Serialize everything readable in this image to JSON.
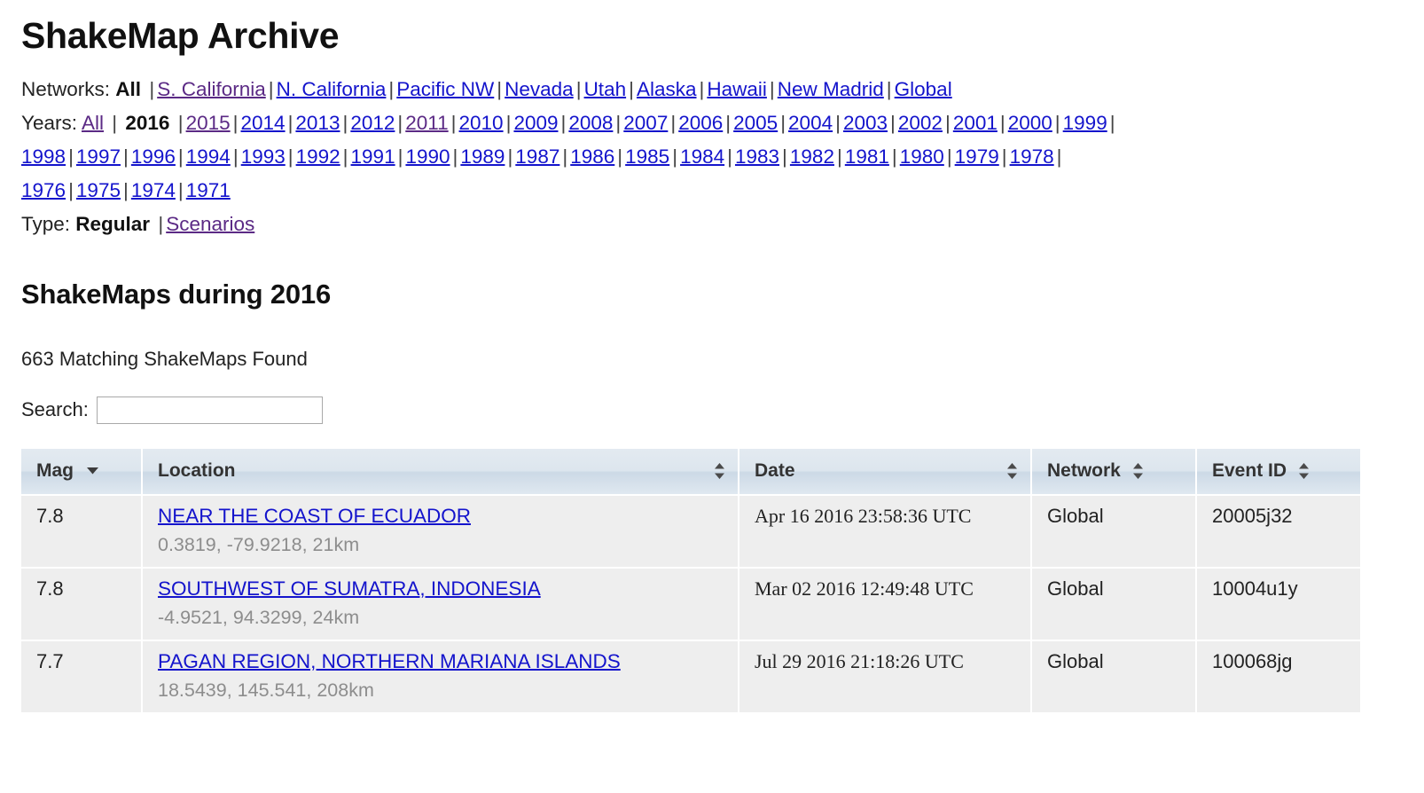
{
  "page": {
    "title": "ShakeMap Archive",
    "section_title": "ShakeMaps during 2016",
    "results_summary": "663 Matching ShakeMaps Found"
  },
  "filters": {
    "networks": {
      "label": "Networks:",
      "current": "All",
      "items": [
        {
          "label": "S. California",
          "visited": true
        },
        {
          "label": "N. California",
          "visited": false
        },
        {
          "label": "Pacific NW",
          "visited": false
        },
        {
          "label": "Nevada",
          "visited": false
        },
        {
          "label": "Utah",
          "visited": false
        },
        {
          "label": "Alaska",
          "visited": false
        },
        {
          "label": "Hawaii",
          "visited": false
        },
        {
          "label": "New Madrid",
          "visited": false
        },
        {
          "label": "Global",
          "visited": false
        }
      ]
    },
    "years": {
      "label": "Years:",
      "current": "2016",
      "all_label": "All",
      "all_visited": true,
      "items": [
        {
          "label": "2015",
          "visited": true
        },
        {
          "label": "2014",
          "visited": false
        },
        {
          "label": "2013",
          "visited": false
        },
        {
          "label": "2012",
          "visited": false
        },
        {
          "label": "2011",
          "visited": true
        },
        {
          "label": "2010",
          "visited": false
        },
        {
          "label": "2009",
          "visited": false
        },
        {
          "label": "2008",
          "visited": false
        },
        {
          "label": "2007",
          "visited": false
        },
        {
          "label": "2006",
          "visited": false
        },
        {
          "label": "2005",
          "visited": false
        },
        {
          "label": "2004",
          "visited": false
        },
        {
          "label": "2003",
          "visited": false
        },
        {
          "label": "2002",
          "visited": false
        },
        {
          "label": "2001",
          "visited": false
        },
        {
          "label": "2000",
          "visited": false
        },
        {
          "label": "1999",
          "visited": false
        },
        {
          "label": "1998",
          "visited": false
        },
        {
          "label": "1997",
          "visited": false
        },
        {
          "label": "1996",
          "visited": false
        },
        {
          "label": "1994",
          "visited": false
        },
        {
          "label": "1993",
          "visited": false
        },
        {
          "label": "1992",
          "visited": false
        },
        {
          "label": "1991",
          "visited": false
        },
        {
          "label": "1990",
          "visited": false
        },
        {
          "label": "1989",
          "visited": false
        },
        {
          "label": "1987",
          "visited": false
        },
        {
          "label": "1986",
          "visited": false
        },
        {
          "label": "1985",
          "visited": false
        },
        {
          "label": "1984",
          "visited": false
        },
        {
          "label": "1983",
          "visited": false
        },
        {
          "label": "1982",
          "visited": false
        },
        {
          "label": "1981",
          "visited": false
        },
        {
          "label": "1980",
          "visited": false
        },
        {
          "label": "1979",
          "visited": false
        },
        {
          "label": "1978",
          "visited": false
        },
        {
          "label": "1976",
          "visited": false
        },
        {
          "label": "1975",
          "visited": false
        },
        {
          "label": "1974",
          "visited": false
        },
        {
          "label": "1971",
          "visited": false
        }
      ]
    },
    "type": {
      "label": "Type:",
      "current": "Regular",
      "items": [
        {
          "label": "Scenarios",
          "visited": true
        }
      ]
    }
  },
  "search": {
    "label": "Search:",
    "value": "",
    "placeholder": ""
  },
  "table": {
    "columns": [
      {
        "key": "mag",
        "label": "Mag",
        "sort": "desc"
      },
      {
        "key": "location",
        "label": "Location",
        "sort": "none"
      },
      {
        "key": "date",
        "label": "Date",
        "sort": "none"
      },
      {
        "key": "network",
        "label": "Network",
        "sort": "none"
      },
      {
        "key": "event_id",
        "label": "Event ID",
        "sort": "none"
      }
    ],
    "rows": [
      {
        "mag": "7.8",
        "location": "NEAR THE COAST OF ECUADOR",
        "coords": "0.3819, -79.9218, 21km",
        "date": "Apr 16 2016 23:58:36 UTC",
        "network": "Global",
        "event_id": "20005j32"
      },
      {
        "mag": "7.8",
        "location": "SOUTHWEST OF SUMATRA, INDONESIA",
        "coords": "-4.9521, 94.3299, 24km",
        "date": "Mar 02 2016 12:49:48 UTC",
        "network": "Global",
        "event_id": "10004u1y"
      },
      {
        "mag": "7.7",
        "location": "PAGAN REGION, NORTHERN MARIANA ISLANDS",
        "coords": "18.5439, 145.541, 208km",
        "date": "Jul 29 2016 21:18:26 UTC",
        "network": "Global",
        "event_id": "100068jg"
      }
    ]
  },
  "colors": {
    "link": "#1414cc",
    "link_visited": "#5b2a85",
    "header_bg": "#dde6ee",
    "row_bg": "#eeeeee",
    "muted_text": "#8d8d8d"
  },
  "separator": "|"
}
